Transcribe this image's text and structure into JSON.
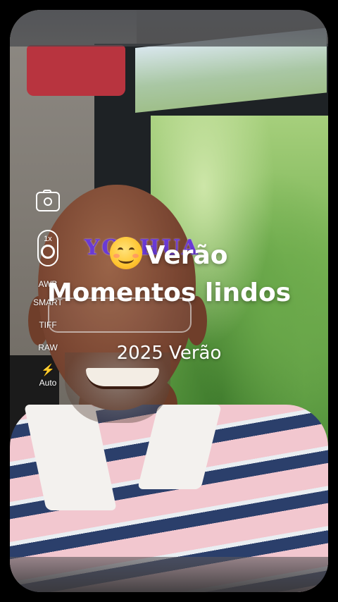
{
  "camera_toolbar": {
    "camera_icon": "camera-switch-icon",
    "zoom_label": "1x",
    "awb_label": "AWB",
    "smart_label": "SMART",
    "tiff_label": "TIFF",
    "raw_label": "RAW",
    "flash_icon": "flash-icon",
    "flash_symbol": "⚡",
    "flash_mode": "Auto"
  },
  "overlay": {
    "watermark": "YOSHUA",
    "emoji_icon": "smiling-face-emoji",
    "title": "Verão",
    "subtitle": "Momentos lindos",
    "year_caption": "2025 Verão"
  },
  "colors": {
    "watermark": "#6a3ad6",
    "text": "#ffffff",
    "background": "#000000"
  }
}
